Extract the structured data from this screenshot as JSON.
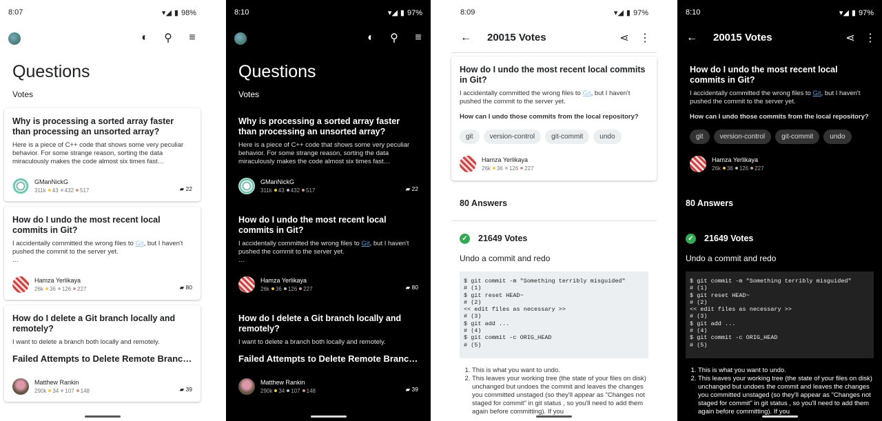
{
  "s1": {
    "time": "8:07",
    "battery": "98%"
  },
  "s2": {
    "time": "8:10",
    "battery": "97%"
  },
  "s3": {
    "time": "8:09",
    "battery": "97%"
  },
  "s4": {
    "time": "8:10",
    "battery": "97%"
  },
  "list": {
    "title": "Questions",
    "sort": "Votes",
    "questions": [
      {
        "title": "Why is processing a sorted array faster than processing an unsorted array?",
        "body": "Here is a piece of C++ code that shows some very peculiar behavior. For some strange reason, sorting the data miraculously makes the code almost six times fast…",
        "user": "GManNickG",
        "rep": "311k",
        "gold": "43",
        "silver": "432",
        "bronze": "517",
        "answers": "22"
      },
      {
        "title": "How do I undo the most recent local commits in Git?",
        "body_pre": "I accidentally committed the wrong files to ",
        "body_link": "Git",
        "body_post": ", but I haven't pushed the commit to the server yet.",
        "body_more": "…",
        "user": "Hamza Yerlikaya",
        "rep": "26k",
        "gold": "36",
        "silver": "126",
        "bronze": "227",
        "answers": "80"
      },
      {
        "title": "How do I delete a Git branch locally and remotely?",
        "body": "I want to delete a branch both locally and remotely.",
        "heading": "Failed Attempts to Delete Remote Branc…",
        "user": "Matthew Rankin",
        "rep": "290k",
        "gold": "34",
        "silver": "107",
        "bronze": "148",
        "answers": "39"
      }
    ]
  },
  "detail": {
    "title": "20015 Votes",
    "q_title": "How do I undo the most recent local commits in Git?",
    "q_body_pre": "I accidentally committed the wrong files to ",
    "q_body_link": "Git",
    "q_body_post": ", but I haven't pushed the commit to the server yet.",
    "q_body2": "How can I undo those commits from the local repository?",
    "tags": [
      "git",
      "version-control",
      "git-commit",
      "undo"
    ],
    "user": "Hamza Yerlikaya",
    "rep": "26k",
    "gold": "36",
    "silver": "126",
    "bronze": "227",
    "answers_heading": "80 Answers",
    "answer_votes": "21649 Votes",
    "answer_title": "Undo a commit and redo",
    "code": "$ git commit -m \"Something terribly misguided\"\n# (1)\n$ git reset HEAD~\n# (2)\n<< edit files as necessary >>\n# (3)\n$ git add ...\n# (4)\n$ git commit -c ORIG_HEAD\n# (5)",
    "li1": "This is what you want to undo.",
    "li2": "This leaves your working tree (the state of your files on disk) unchanged but undoes the commit and leaves the changes you committed unstaged (so they'll appear as \"Changes not staged for commit\" in  git status , so you'll need to add them again before committing). If you"
  },
  "icons": {
    "theme": "◐",
    "search": "⚲",
    "sort": "≡",
    "back": "←",
    "share": "⋖",
    "more": "⋮",
    "comment": "▰",
    "check": "✓"
  }
}
